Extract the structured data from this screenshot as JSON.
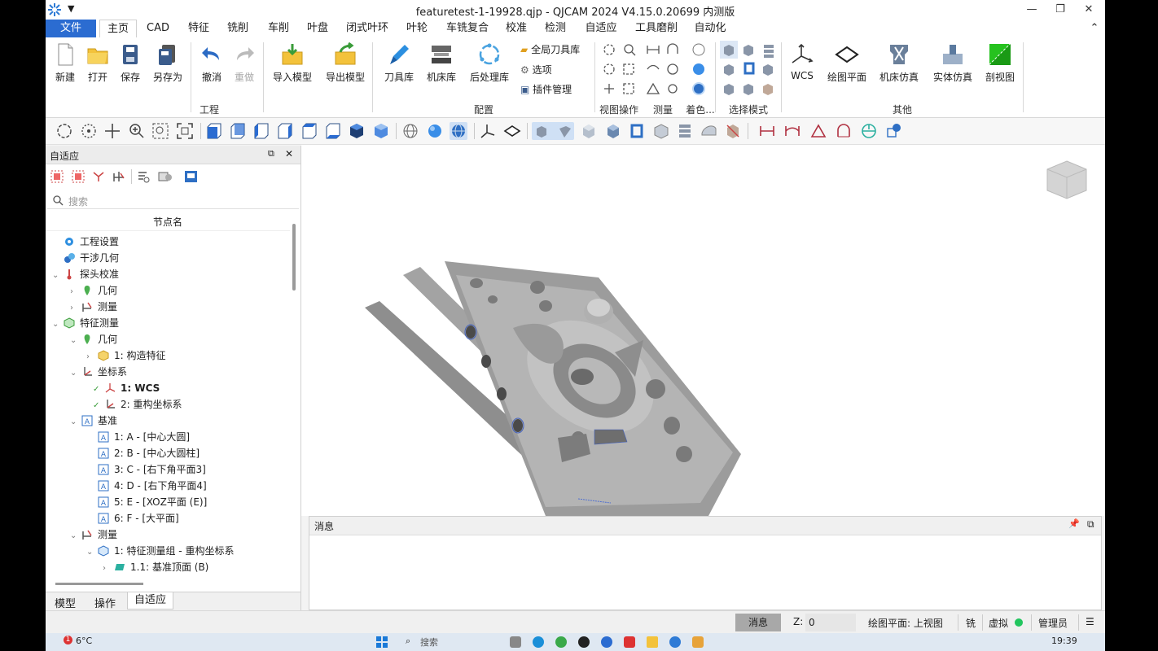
{
  "app": {
    "title": "featuretest-1-19928.qjp - QJCAM 2024 V4.15.0.20699 内测版",
    "quick_access": "▼",
    "win_controls": {
      "minimize": "—",
      "maximize": "❐",
      "close": "✕"
    }
  },
  "menu": {
    "tabs": [
      "文件",
      "主页",
      "CAD",
      "特征",
      "铣削",
      "车削",
      "叶盘",
      "闭式叶环",
      "叶轮",
      "车铣复合",
      "校准",
      "检测",
      "自适应",
      "工具磨削",
      "自动化"
    ],
    "collapse": "⌃"
  },
  "ribbon": {
    "buttons": {
      "new": "新建",
      "open": "打开",
      "save": "保存",
      "save_as": "另存为",
      "undo": "撤消",
      "redo": "重做",
      "import_model": "导入模型",
      "export_model": "导出模型",
      "tool_lib": "刀具库",
      "machine_lib": "机床库",
      "post_lib": "后处理库",
      "wcs": "WCS",
      "draw_plane": "绘图平面",
      "machine_sim": "机床仿真",
      "solid_sim": "实体仿真",
      "section_view": "剖视图"
    },
    "small": {
      "global_tool_lib": "全局刀具库",
      "options": "选项",
      "plugin_mgr": "插件管理"
    },
    "groups": {
      "project": "工程",
      "config": "配置",
      "view_ops": "视图操作",
      "measure": "测量",
      "shading": "着色...",
      "select_mode": "选择模式",
      "other": "其他"
    }
  },
  "panel": {
    "title": "自适应",
    "pin": "⧉",
    "close": "✕",
    "search_placeholder": "搜索",
    "column": "节点名",
    "nodes": [
      {
        "label": "工程设置",
        "bold": false
      },
      {
        "label": "干涉几何",
        "bold": false
      },
      {
        "label": "探头校准",
        "bold": false
      },
      {
        "label": "几何",
        "bold": false
      },
      {
        "label": "测量",
        "bold": false
      },
      {
        "label": "特征测量",
        "bold": false
      },
      {
        "label": "几何",
        "bold": false
      },
      {
        "label": "1: 构造特征",
        "bold": false
      },
      {
        "label": "坐标系",
        "bold": false
      },
      {
        "label": "1: WCS",
        "bold": true
      },
      {
        "label": "2: 重构坐标系",
        "bold": false
      },
      {
        "label": "基准",
        "bold": false
      },
      {
        "label": "1: A - [中心大圆]",
        "bold": false
      },
      {
        "label": "2: B - [中心大圆柱]",
        "bold": false
      },
      {
        "label": "3: C - [右下角平面3]",
        "bold": false
      },
      {
        "label": "4: D - [右下角平面4]",
        "bold": false
      },
      {
        "label": "5: E - [XOZ平面 (E)]",
        "bold": false
      },
      {
        "label": "6: F - [大平面]",
        "bold": false
      },
      {
        "label": "测量",
        "bold": false
      },
      {
        "label": "1: 特征测量组 - 重构坐标系",
        "bold": false
      },
      {
        "label": "1.1: 基准顶面 (B)",
        "bold": false
      }
    ],
    "bottom_tabs": [
      "模型",
      "操作",
      "自适应"
    ]
  },
  "messages": {
    "title": "消息",
    "pin": "📌",
    "restore": "⧉"
  },
  "status": {
    "msg_button": "消息",
    "z_label": "Z:",
    "z_value": "0",
    "plane": "绘图平面: 上视图",
    "mode": "铣",
    "virtual": "虚拟",
    "user": "管理员",
    "status_color": "#22c55e"
  },
  "taskbar": {
    "weather": "6°C",
    "search": "搜索",
    "time": "19:39"
  }
}
